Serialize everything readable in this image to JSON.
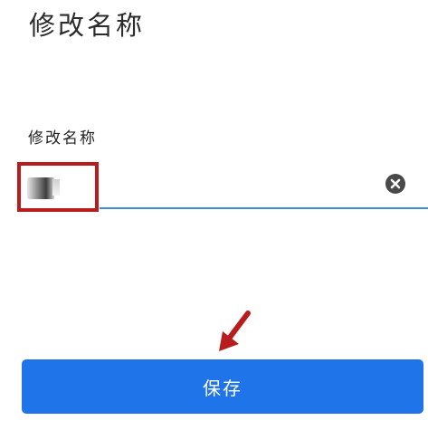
{
  "header": {
    "title": "修改名称"
  },
  "form": {
    "field_label": "修改名称",
    "input_value": "",
    "clear_icon": "clear-circle-icon"
  },
  "actions": {
    "save_label": "保存"
  },
  "annotations": {
    "highlight_color": "#b81c1c",
    "arrow_icon": "arrow-down-left-icon"
  },
  "colors": {
    "primary": "#1f74ea",
    "underline": "#3a8fd8"
  }
}
